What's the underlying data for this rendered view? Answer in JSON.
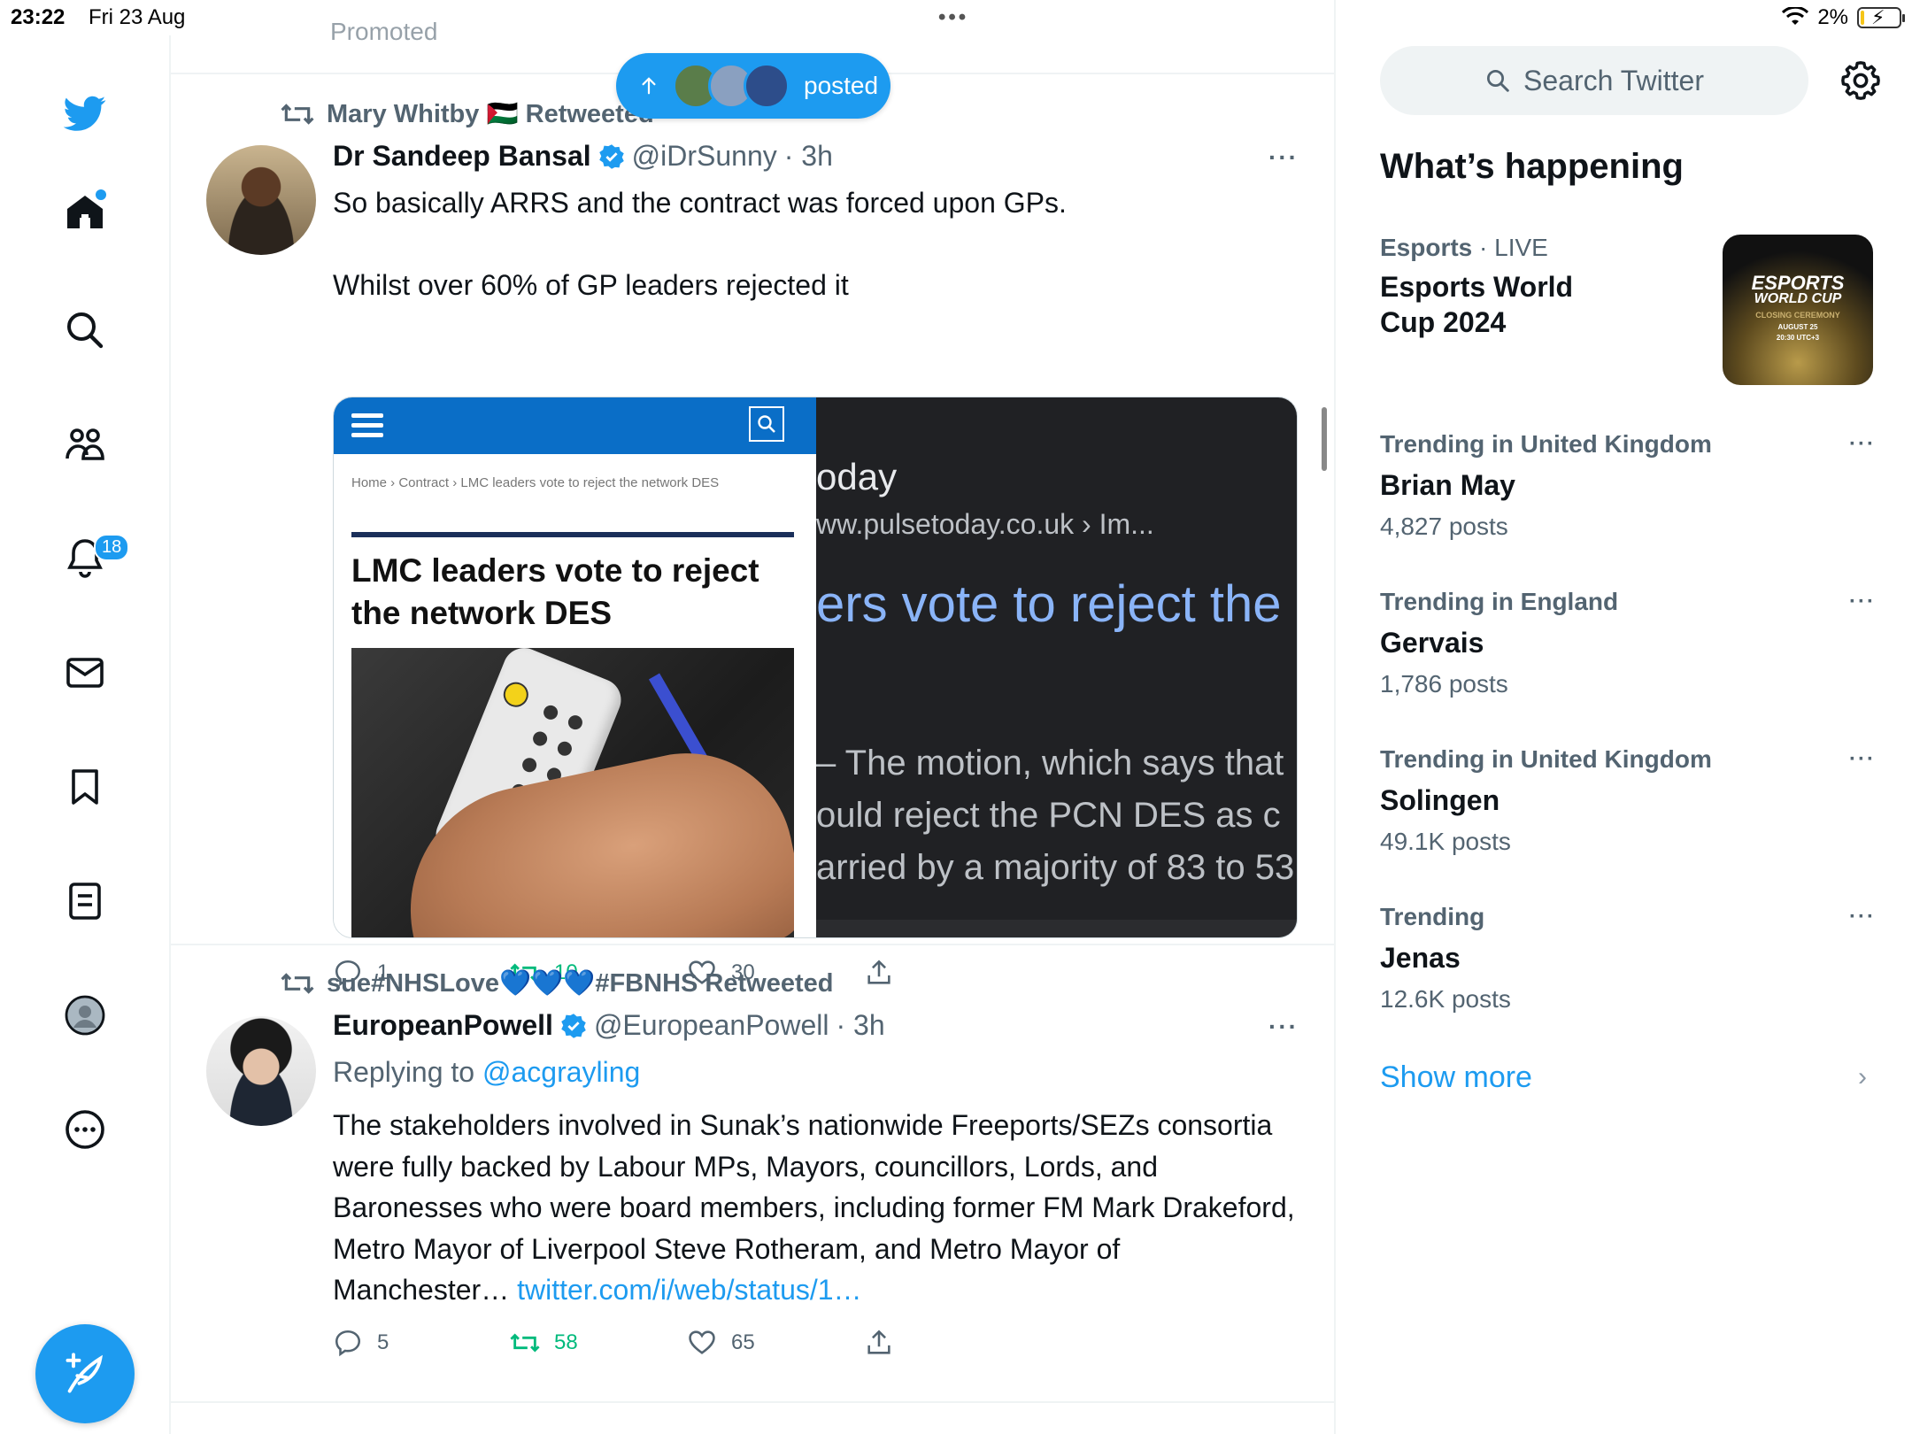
{
  "status_bar": {
    "time": "23:22",
    "date": "Fri 23 Aug",
    "dots": "•••",
    "battery": "2%",
    "battery_level": 0.02
  },
  "nav": {
    "notifications_badge": "18"
  },
  "timeline": {
    "promoted_partial": "Promoted",
    "new_posts_pill": "posted",
    "tweets": [
      {
        "retweeted_by": "Mary Whitby 🇵🇸 Retweeted",
        "name": "Dr Sandeep Bansal",
        "handle": "@iDrSunny",
        "time": "· 3h",
        "more": "···",
        "text_line1": "So basically ARRS and the contract was forced upon GPs.",
        "text_line2": "Whilst over 60% of GP leaders rejected it",
        "media_left": {
          "breadcrumb": "Home › Contract › LMC leaders vote to reject the network DES",
          "headline": "LMC leaders vote to reject the network DES"
        },
        "media_right": {
          "line1": "oday",
          "line2": "ww.pulsetoday.co.uk › Im...",
          "line3": "ers vote to reject the",
          "line4": "– The motion, which says that",
          "line5": "ould reject the PCN DES as c",
          "line6": "arried by a majority of 83 to 53"
        },
        "replies": "1",
        "retweets": "10",
        "likes": "30"
      },
      {
        "retweeted_by": "sue#NHSLove💙💙💙#FBNHS Retweeted",
        "name": "EuropeanPowell",
        "handle": "@EuropeanPowell",
        "time": "· 3h",
        "more": "···",
        "replying_prefix": "Replying to",
        "replying_to": "@acgrayling",
        "text": "The stakeholders involved in Sunak’s nationwide Freeports/SEZs consortia were fully backed by Labour MPs, Mayors, councillors, Lords, and Baronesses who were board members, including former FM Mark Drakeford, Metro Mayor of Liverpool Steve Rotheram, and Metro Mayor of Manchester…",
        "link": "twitter.com/i/web/status/1…",
        "replies": "5",
        "retweets": "58",
        "likes": "65"
      }
    ]
  },
  "sidebar": {
    "search_placeholder": "Search Twitter",
    "section_title": "What’s happening",
    "esports": {
      "category": "Esports",
      "live": "· LIVE",
      "title_line1": "Esports World",
      "title_line2": "Cup 2024",
      "image_text1": "ESPORTS",
      "image_text2": "WORLD CUP",
      "image_text3": "CLOSING CEREMONY",
      "image_text4": "AUGUST 25",
      "image_text5": "20:30 UTC+3"
    },
    "trends": [
      {
        "category": "Trending in United Kingdom",
        "name": "Brian May",
        "count": "4,827 posts"
      },
      {
        "category": "Trending in England",
        "name": "Gervais",
        "count": "1,786 posts"
      },
      {
        "category": "Trending in United Kingdom",
        "name": "Solingen",
        "count": "49.1K posts"
      },
      {
        "category": "Trending",
        "name": "Jenas",
        "count": "12.6K posts"
      }
    ],
    "trend_more": "···",
    "show_more": "Show more",
    "chevron": "›"
  },
  "colors": {
    "accent": "#1d9bf0",
    "retweet_green": "#00ba7c",
    "muted": "#536471"
  }
}
